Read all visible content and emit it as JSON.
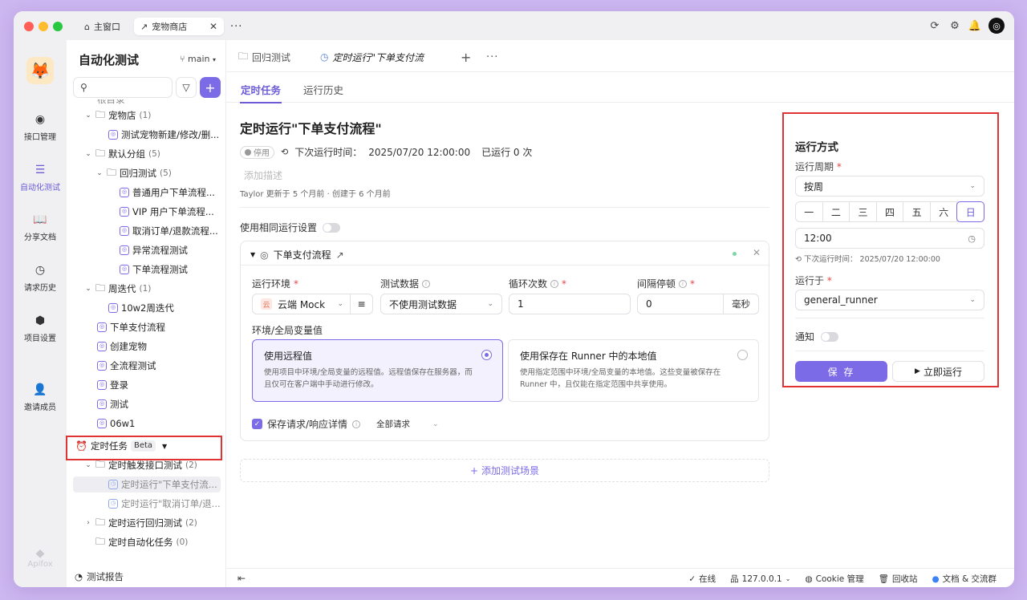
{
  "window": {
    "tabs": [
      {
        "label": "主窗口"
      },
      {
        "label": "宠物商店"
      }
    ],
    "more": "···"
  },
  "rail": {
    "brand_icon": "fox-logo",
    "items": [
      {
        "label": "接口管理",
        "icon": "api-icon"
      },
      {
        "label": "自动化测试",
        "icon": "automation-icon"
      },
      {
        "label": "分享文档",
        "icon": "book-icon"
      },
      {
        "label": "请求历史",
        "icon": "history-icon"
      },
      {
        "label": "项目设置",
        "icon": "settings-icon"
      },
      {
        "label": "邀请成员",
        "icon": "add-user-icon"
      }
    ],
    "footer": "Apifox"
  },
  "sidebar": {
    "title": "自动化测试",
    "branch": "main",
    "tree": [
      {
        "label": "根目录"
      },
      {
        "label": "宠物店",
        "count": "(1)"
      },
      {
        "label": "测试宠物新建/修改/删..."
      },
      {
        "label": "默认分组",
        "count": "(5)"
      },
      {
        "label": "回归测试",
        "count": "(5)"
      },
      {
        "label": "普通用户下单流程..."
      },
      {
        "label": "VIP 用户下单流程..."
      },
      {
        "label": "取消订单/退款流程..."
      },
      {
        "label": "异常流程测试"
      },
      {
        "label": "下单流程测试"
      },
      {
        "label": "周迭代",
        "count": "(1)"
      },
      {
        "label": "10w2周迭代"
      },
      {
        "label": "下单支付流程"
      },
      {
        "label": "创建宠物"
      },
      {
        "label": "全流程测试"
      },
      {
        "label": "登录"
      },
      {
        "label": "测试"
      },
      {
        "label": "06w1"
      },
      {
        "label": "定时任务",
        "badge": "Beta"
      },
      {
        "label": "定时触发接口测试",
        "count": "(2)"
      },
      {
        "label": "定时运行\"下单支付流..."
      },
      {
        "label": "定时运行\"取消订单/退..."
      },
      {
        "label": "定时运行回归测试",
        "count": "(2)"
      },
      {
        "label": "定时自动化任务",
        "count": "(0)"
      }
    ],
    "footer": "测试报告"
  },
  "main": {
    "tabs": [
      {
        "label": "回归测试"
      },
      {
        "label": "定时运行\"下单支付流"
      }
    ],
    "subtabs": [
      {
        "label": "定时任务"
      },
      {
        "label": "运行历史"
      }
    ],
    "title": "定时运行\"下单支付流程\"",
    "status": {
      "disabled": "停用",
      "next_run_label": "下次运行时间：",
      "next_run_value": "2025/07/20 12:00:00",
      "run_count": "已运行 0 次"
    },
    "description_placeholder": "添加描述",
    "meta": "Taylor 更新于 5 个月前 · 创建于 6 个月前",
    "same_setting": "使用相同运行设置",
    "card": {
      "name": "下单支付流程",
      "env_label": "运行环境",
      "env_value": "云端 Mock",
      "env_tag": "云",
      "data_label": "测试数据",
      "data_value": "不使用测试数据",
      "loop_label": "循环次数",
      "loop_value": "1",
      "interval_label": "间隔停顿",
      "interval_value": "0",
      "interval_unit": "毫秒",
      "vars_label": "环境/全局变量值",
      "options": [
        {
          "title": "使用远程值",
          "desc": "使用项目中环境/全局变量的远程值。远程值保存在服务器，而且仅可在客户端中手动进行修改。"
        },
        {
          "title": "使用保存在 Runner 中的本地值",
          "desc": "使用指定范围中环境/全局变量的本地值。这些变量被保存在 Runner 中，且仅能在指定范围中共享使用。"
        }
      ],
      "save_details": "保存请求/响应详情",
      "save_scope": "全部请求"
    },
    "add_scene": "添加测试场景"
  },
  "run_panel": {
    "title": "运行方式",
    "period_label": "运行周期",
    "period_value": "按周",
    "days": [
      "一",
      "二",
      "三",
      "四",
      "五",
      "六",
      "日"
    ],
    "selected_day": "日",
    "time_value": "12:00",
    "next_run": "下次运行时间： 2025/07/20 12:00:00",
    "runner_label": "运行于",
    "runner_value": "general_runner",
    "notify_label": "通知",
    "save": "保 存",
    "run_now": "立即运行"
  },
  "statusbar": {
    "items": [
      {
        "label": "在线"
      },
      {
        "label": "127.0.0.1"
      },
      {
        "label": "Cookie 管理"
      },
      {
        "label": "回收站"
      },
      {
        "label": "文档 & 交流群"
      }
    ]
  },
  "colors": {
    "accent": "#7b6be6",
    "highlight_box": "#e03434",
    "desktop": "#cdb7f0"
  }
}
